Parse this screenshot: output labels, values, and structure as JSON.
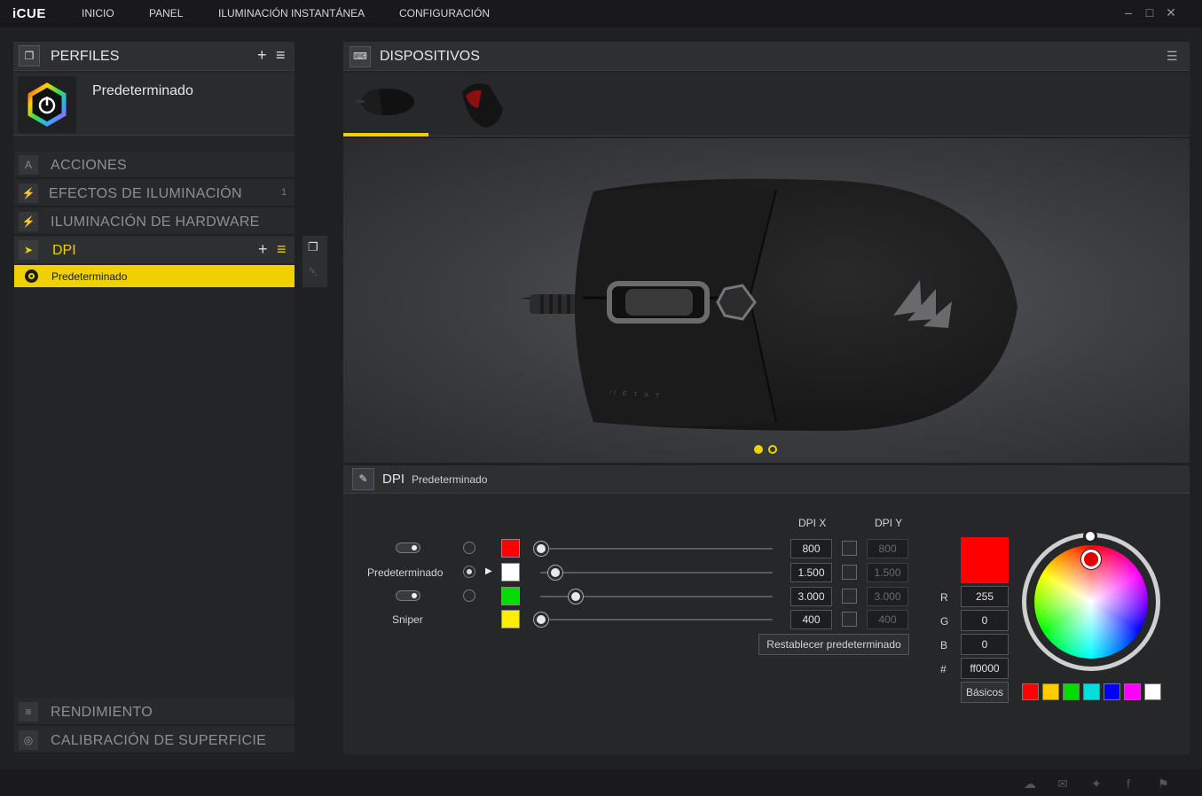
{
  "app": {
    "brand": "iCUE",
    "nav": [
      "INICIO",
      "PANEL",
      "ILUMINACIÓN INSTANTÁNEA",
      "CONFIGURACIÓN"
    ]
  },
  "profiles": {
    "title": "PERFILES",
    "add": "+",
    "menu": "≡",
    "active_profile": "Predeterminado"
  },
  "sections": {
    "actions": "ACCIONES",
    "lighting_effects": "EFECTOS DE ILUMINACIÓN",
    "lighting_effects_count": "1",
    "hardware_lighting": "ILUMINACIÓN DE HARDWARE",
    "dpi": "DPI",
    "dpi_item": "Predeterminado",
    "performance": "RENDIMIENTO",
    "surface_calibration": "CALIBRACIÓN DE SUPERFICIE"
  },
  "devices": {
    "title": "DISPOSITIVOS",
    "thumbnails": [
      "mouse-black",
      "mouse-red"
    ],
    "selected_index": 0,
    "carousel_dots": 2,
    "carousel_active": 0,
    "device_model_print": "// E T X T"
  },
  "dpi_panel": {
    "title": "DPI",
    "subtitle": "Predeterminado",
    "col_dpi_x": "DPI X",
    "col_dpi_y": "DPI Y",
    "stages": [
      {
        "label": "",
        "toggle": true,
        "radio": false,
        "arrow": false,
        "color": "#ff0000",
        "fraction": 0.0,
        "dpi_x": "800",
        "dpi_y": "800"
      },
      {
        "label": "Predeterminado",
        "toggle": false,
        "radio": true,
        "arrow": true,
        "color": "#ffffff",
        "fraction": 0.06,
        "dpi_x": "1.500",
        "dpi_y": "1.500"
      },
      {
        "label": "",
        "toggle": true,
        "radio": false,
        "arrow": false,
        "color": "#00dd00",
        "fraction": 0.15,
        "dpi_x": "3.000",
        "dpi_y": "3.000"
      },
      {
        "label": "Sniper",
        "toggle": false,
        "radio": false,
        "arrow": false,
        "color": "#ffee00",
        "fraction": 0.0,
        "dpi_x": "400",
        "dpi_y": "400"
      }
    ],
    "reset_button": "Restablecer predeterminado"
  },
  "color_picker": {
    "preview": "#ff0000",
    "r_label": "R",
    "r": "255",
    "g_label": "G",
    "g": "0",
    "b_label": "B",
    "b": "0",
    "hex_label": "#",
    "hex": "ff0000",
    "basics_button": "Básicos",
    "palette": [
      "#ff0000",
      "#ffcc00",
      "#00dd00",
      "#00dddd",
      "#0000ff",
      "#ff00ff",
      "#ffffff"
    ]
  },
  "theme": {
    "accent": "#f0d000"
  }
}
